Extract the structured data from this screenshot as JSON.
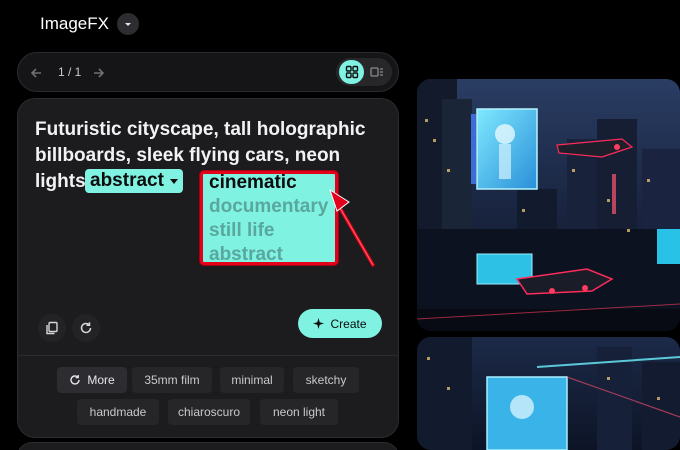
{
  "header": {
    "app_title": "ImageFX"
  },
  "pager": {
    "count": "1 / 1"
  },
  "prompt": {
    "line1": "Futuristic cityscape, tall holographic",
    "line2": "billboards, sleek flying cars, neon",
    "line3_start": "lights",
    "chip_abstract": "abstract",
    "chip_cinematic": "cinematic"
  },
  "dropdown": {
    "selected": "cinematic",
    "options": [
      "documentary",
      "still life",
      "abstract"
    ]
  },
  "actions": {
    "create_label": "Create"
  },
  "tags": {
    "more": "More",
    "items": [
      "35mm film",
      "minimal",
      "sketchy",
      "handmade",
      "chiaroscuro",
      "neon light"
    ]
  },
  "colors": {
    "accent": "#7ff2e2",
    "annotation": "#e3001b",
    "background": "#000000",
    "card": "#1c1c1f"
  }
}
